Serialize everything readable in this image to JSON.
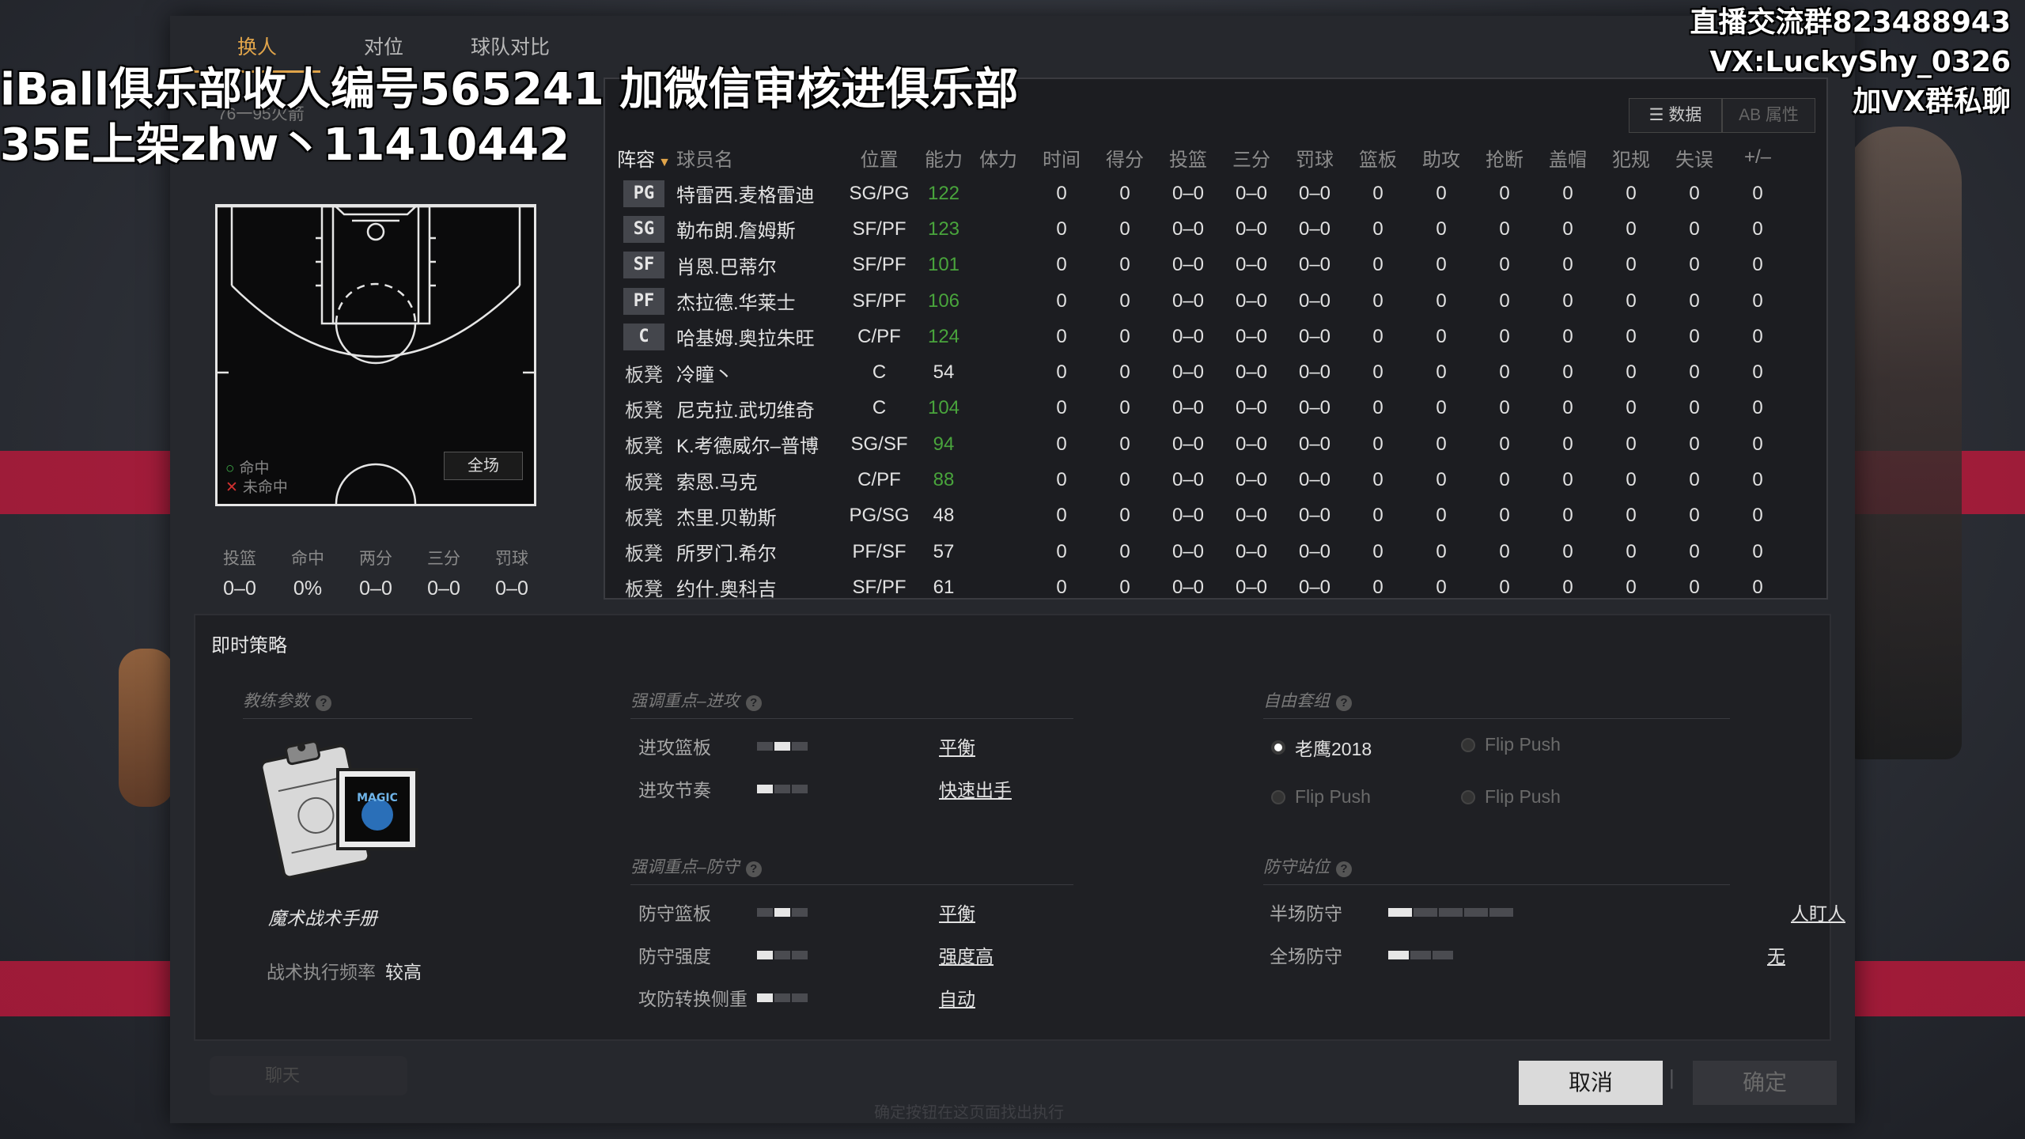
{
  "tabs": [
    {
      "label": "换人",
      "active": true
    },
    {
      "label": "对位",
      "active": false
    },
    {
      "label": "球队对比",
      "active": false
    }
  ],
  "shot_panel": {
    "team_sub": "76一95火箭",
    "legend_made": "命中",
    "legend_missed": "未命中",
    "full_button": "全场",
    "stats": [
      {
        "label": "投篮",
        "value": "0–0"
      },
      {
        "label": "命中",
        "value": "0%"
      },
      {
        "label": "两分",
        "value": "0–0"
      },
      {
        "label": "三分",
        "value": "0–0"
      },
      {
        "label": "罚球",
        "value": "0–0"
      }
    ]
  },
  "view_toggle": {
    "data_label": "数据",
    "attr_label": "属性"
  },
  "roster": {
    "headers": [
      "阵容",
      "球员名",
      "位置",
      "能力",
      "体力",
      "时间",
      "得分",
      "投篮",
      "三分",
      "罚球",
      "篮板",
      "助攻",
      "抢断",
      "盖帽",
      "犯规",
      "失误",
      "+/–"
    ],
    "rows": [
      {
        "slot": "PG",
        "starter": true,
        "name": "特雷西.麦格雷迪",
        "pos": "SG/PG",
        "ovr": "122",
        "ovr_color": "green"
      },
      {
        "slot": "SG",
        "starter": true,
        "name": "勒布朗.詹姆斯",
        "pos": "SF/PF",
        "ovr": "123",
        "ovr_color": "green"
      },
      {
        "slot": "SF",
        "starter": true,
        "name": "肖恩.巴蒂尔",
        "pos": "SF/PF",
        "ovr": "101",
        "ovr_color": "green"
      },
      {
        "slot": "PF",
        "starter": true,
        "name": "杰拉德.华莱士",
        "pos": "SF/PF",
        "ovr": "106",
        "ovr_color": "green"
      },
      {
        "slot": "C",
        "starter": true,
        "name": "哈基姆.奥拉朱旺",
        "pos": "C/PF",
        "ovr": "124",
        "ovr_color": "green"
      },
      {
        "slot": "板凳",
        "starter": false,
        "name": "冷瞳丶",
        "pos": "C",
        "ovr": "54",
        "ovr_color": "white"
      },
      {
        "slot": "板凳",
        "starter": false,
        "name": "尼克拉.武切维奇",
        "pos": "C",
        "ovr": "104",
        "ovr_color": "green"
      },
      {
        "slot": "板凳",
        "starter": false,
        "name": "K.考德威尔–普博",
        "pos": "SG/SF",
        "ovr": "94",
        "ovr_color": "green"
      },
      {
        "slot": "板凳",
        "starter": false,
        "name": "索恩.马克",
        "pos": "C/PF",
        "ovr": "88",
        "ovr_color": "green"
      },
      {
        "slot": "板凳",
        "starter": false,
        "name": "杰里.贝勒斯",
        "pos": "PG/SG",
        "ovr": "48",
        "ovr_color": "white"
      },
      {
        "slot": "板凳",
        "starter": false,
        "name": "所罗门.希尔",
        "pos": "PF/SF",
        "ovr": "57",
        "ovr_color": "white"
      },
      {
        "slot": "板凳",
        "starter": false,
        "name": "约什.奥科吉",
        "pos": "SF/PF",
        "ovr": "61",
        "ovr_color": "white"
      }
    ],
    "stat_values": [
      "0",
      "0",
      "0–0",
      "0–0",
      "0–0",
      "0",
      "0",
      "0",
      "0",
      "0",
      "0",
      "0"
    ]
  },
  "strategy": {
    "title": "即时策略",
    "coach_head": "教练参数",
    "playbook_name": "魔术战术手册",
    "exec_label": "战术执行频率",
    "exec_value": "较高",
    "offense_head": "强调重点–进攻",
    "offense": [
      {
        "label": "进攻篮板",
        "value": "平衡",
        "level": 2,
        "total": 3
      },
      {
        "label": "进攻节奏",
        "value": "快速出手",
        "level": 1,
        "total": 3
      }
    ],
    "defense_head": "强调重点–防守",
    "defense": [
      {
        "label": "防守篮板",
        "value": "平衡",
        "level": 2,
        "total": 3
      },
      {
        "label": "防守强度",
        "value": "强度高",
        "level": 1,
        "total": 3
      },
      {
        "label": "攻防转换侧重",
        "value": "自动",
        "level": 1,
        "total": 3
      }
    ],
    "sets_head": "自由套组",
    "sets": [
      {
        "label": "老鹰2018",
        "selected": true
      },
      {
        "label": "Flip Push",
        "selected": false
      },
      {
        "label": "Flip Push",
        "selected": false
      },
      {
        "label": "Flip Push",
        "selected": false
      }
    ],
    "stance_head": "防守站位",
    "stance": [
      {
        "label": "半场防守",
        "value": "人盯人",
        "level": 1,
        "total": 5
      },
      {
        "label": "全场防守",
        "value": "无",
        "level": 1,
        "total": 3
      }
    ]
  },
  "footer": {
    "chat_label": "聊天",
    "note": "确定按钮在这页面找出执行",
    "cancel": "取消",
    "ok": "确定"
  },
  "overlay": {
    "line1": "iBall俱乐部收人编号565241 加微信审核进俱乐部",
    "line2": "35E上架zhw丶11410442",
    "right1": "直播交流群823488943",
    "right2": "VX:LuckyShy_0326",
    "right3": "加VX群私聊"
  },
  "colors": {
    "accent": "#e0a44a",
    "ovr_green": "#49a43c",
    "brand_red": "#c8183d"
  }
}
